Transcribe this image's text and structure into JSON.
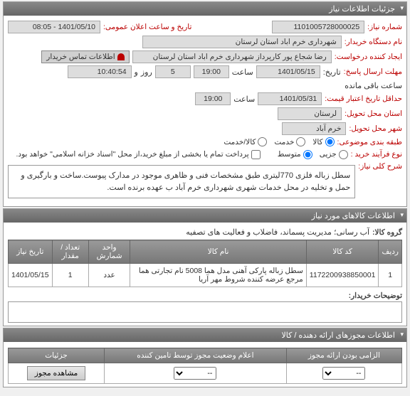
{
  "panel1": {
    "title": "جزئیات اطلاعات نیاز",
    "requestNumber_label": "شماره نیاز:",
    "requestNumber": "1101005728000025",
    "publicDate_label": "تاریخ و ساعت اعلان عمومی:",
    "publicDate": "1401/05/10 - 08:05",
    "buyerDevice_label": "نام دستگاه خریدار:",
    "buyerDevice": "شهرداری خرم اباد استان لرستان",
    "requester_label": "ایجاد کننده درخواست:",
    "requester": "رضا شجاع پور کارپرداز شهرداری خرم اباد استان لرستان",
    "contactBtn": "اطلاعات تماس خریدار",
    "answerDeadline_label": "مهلت ارسال پاسخ:",
    "date1": "1401/05/15",
    "time_label": "ساعت",
    "time1": "19:00",
    "day_label": "روز",
    "dayVal": "5",
    "and_label": "و",
    "remain": "10:40:54",
    "remain_label": "ساعت باقی مانده",
    "creditDeadline_label": "حداقل تاریخ اعتبار قیمت:",
    "date2": "1401/05/31",
    "time2": "19:00",
    "province_label": "استان محل تحویل:",
    "province": "لرستان",
    "city_label": "شهر محل تحویل:",
    "city": "خرم آباد",
    "category_label": "طبقه بندی موضوعی:",
    "cat_goods": "کالا",
    "cat_service": "خدمت",
    "cat_both": "کالا/خدمت",
    "buyProcess_label": "نوع فرآیند خرید :",
    "proc_small": "جزیی",
    "proc_medium": "متوسط",
    "paymentNote": "پرداخت تمام یا بخشی از مبلغ خرید،از محل \"اسناد خزانه اسلامی\" خواهد بود.",
    "desc_label": "شرح کلی نیاز:",
    "desc": "سطل زباله فلزی 770لیتری طبق مشخصات فنی و ظاهری موجود در مدارک پیوست.ساخت و بارگیری و حمل و تخلیه در محل خدمات شهری شهرداری خرم آباد ب عهده برنده است."
  },
  "panel2": {
    "title": "اطلاعات کالاهای مورد نیاز",
    "goodsGroup_label": "گروه کالا:",
    "goodsGroup": "آب رسانی؛ مدیریت پسماند، فاضلاب و فعالیت های تصفیه",
    "cols": {
      "row": "ردیف",
      "code": "کد کالا",
      "name": "نام کالا",
      "unit": "واحد شمارش",
      "qty": "تعداد / مقدار",
      "date": "تاریخ نیاز"
    },
    "rows": [
      {
        "idx": "1",
        "code": "1172200938850001",
        "name": "سطل زباله پارکی آهنی مدل هما 5008 نام تجارتی هما مرجع عرضه کننده شروط مهر آریا",
        "unit": "عدد",
        "qty": "1",
        "date": "1401/05/15"
      }
    ],
    "buyerComments_label": "توضیحات خریدار:"
  },
  "panel3": {
    "title": "اطلاعات مجوزهای ارائه دهنده / کالا",
    "cols": {
      "mandatory": "الزامی بودن ارائه مجوز",
      "status": "اعلام وضعیت مجوز توسط تامین کننده",
      "details": "جزئیات"
    },
    "status_placeholder": "--",
    "detailBtn": "مشاهده مجوز"
  }
}
